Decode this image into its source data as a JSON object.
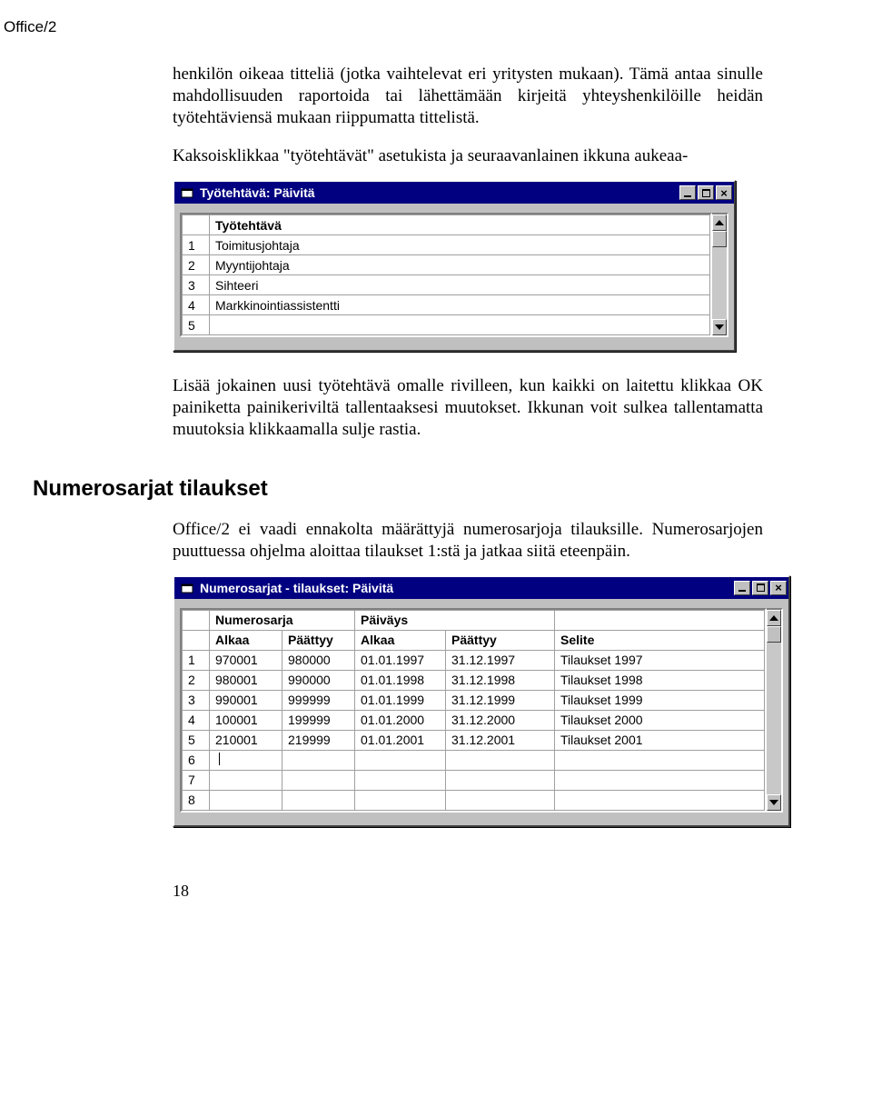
{
  "header": {
    "tag": "Office/2"
  },
  "text": {
    "intro1": "henkilön oikeaa titteliä (jotka vaihtelevat eri yritysten mukaan). Tämä antaa sinulle mahdollisuuden raportoida tai lähettämään kirjeitä yhteyshenkilöille heidän työtehtäviensä mukaan riippumatta tittelistä.",
    "intro2": "Kaksoisklikkaa \"työtehtävät\" asetukista ja seuraavanlainen ikkuna aukeaa-",
    "after1": "Lisää jokainen uusi työtehtävä omalle rivilleen, kun kaikki on laitettu klikkaa OK painiketta painikeriviltä tallentaaksesi muutokset. Ikkunan voit sulkea tallentamatta muutoksia klikkaamalla sulje rastia.",
    "section_heading": "Numerosarjat tilaukset",
    "section_body": "Office/2 ei vaadi ennakolta määrättyjä numerosarjoja tilauksille. Numerosarjojen puuttuessa ohjelma aloittaa tilaukset 1:stä ja jatkaa siitä eteenpäin.",
    "pagenum": "18"
  },
  "window1": {
    "title": "Työtehtävä: Päivitä",
    "column": "Työtehtävä",
    "rows": [
      "Toimitusjohtaja",
      "Myyntijohtaja",
      "Sihteeri",
      "Markkinointiassistentti",
      ""
    ]
  },
  "window2": {
    "title": "Numerosarjat - tilaukset: Päivitä",
    "group1": "Numerosarja",
    "group2": "Päiväys",
    "cols": [
      "Alkaa",
      "Päättyy",
      "Alkaa",
      "Päättyy",
      "Selite"
    ],
    "rows": [
      [
        "970001",
        "980000",
        "01.01.1997",
        "31.12.1997",
        "Tilaukset 1997"
      ],
      [
        "980001",
        "990000",
        "01.01.1998",
        "31.12.1998",
        "Tilaukset 1998"
      ],
      [
        "990001",
        "999999",
        "01.01.1999",
        "31.12.1999",
        "Tilaukset 1999"
      ],
      [
        "100001",
        "199999",
        "01.01.2000",
        "31.12.2000",
        "Tilaukset 2000"
      ],
      [
        "210001",
        "219999",
        "01.01.2001",
        "31.12.2001",
        "Tilaukset 2001"
      ],
      [
        "",
        "",
        "",
        "",
        ""
      ],
      [
        "",
        "",
        "",
        "",
        ""
      ],
      [
        "",
        "",
        "",
        "",
        ""
      ]
    ]
  },
  "chart_data": {
    "type": "table",
    "tables": [
      {
        "title": "Työtehtävä",
        "columns": [
          "Työtehtävä"
        ],
        "rows": [
          [
            "Toimitusjohtaja"
          ],
          [
            "Myyntijohtaja"
          ],
          [
            "Sihteeri"
          ],
          [
            "Markkinointiassistentti"
          ],
          [
            ""
          ]
        ]
      },
      {
        "title": "Numerosarjat - tilaukset",
        "columns": [
          "Numerosarja Alkaa",
          "Numerosarja Päättyy",
          "Päiväys Alkaa",
          "Päiväys Päättyy",
          "Selite"
        ],
        "rows": [
          [
            "970001",
            "980000",
            "01.01.1997",
            "31.12.1997",
            "Tilaukset 1997"
          ],
          [
            "980001",
            "990000",
            "01.01.1998",
            "31.12.1998",
            "Tilaukset 1998"
          ],
          [
            "990001",
            "999999",
            "01.01.1999",
            "31.12.1999",
            "Tilaukset 1999"
          ],
          [
            "100001",
            "199999",
            "01.01.2000",
            "31.12.2000",
            "Tilaukset 2000"
          ],
          [
            "210001",
            "219999",
            "01.01.2001",
            "31.12.2001",
            "Tilaukset 2001"
          ]
        ]
      }
    ]
  }
}
